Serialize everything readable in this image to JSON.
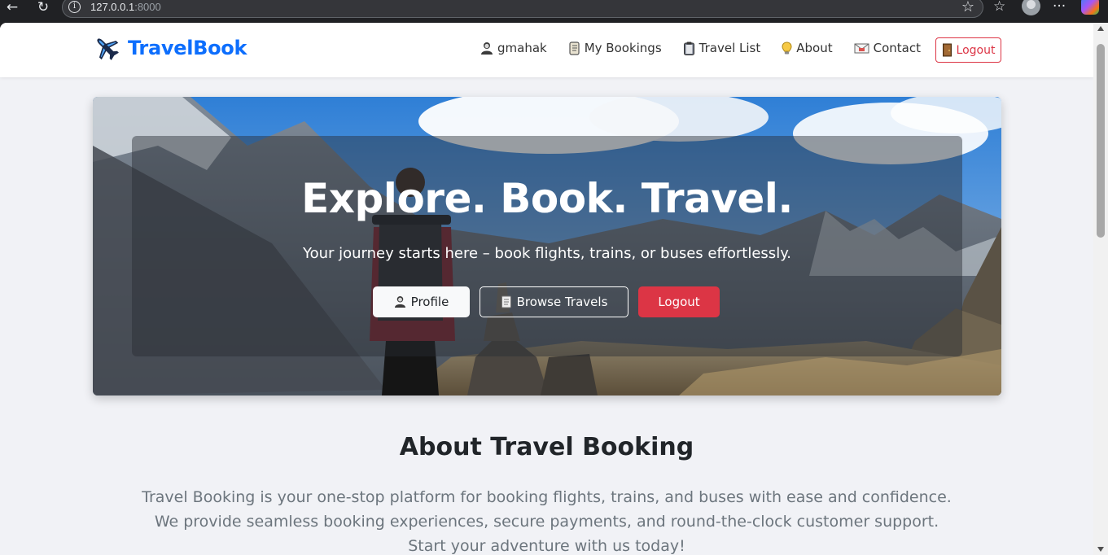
{
  "browser": {
    "url_host": "127.0.0.1",
    "url_port": ":8000"
  },
  "navbar": {
    "brand": "TravelBook",
    "links": [
      {
        "label": "gmahak",
        "icon": "user-icon"
      },
      {
        "label": "My Bookings",
        "icon": "scroll-icon"
      },
      {
        "label": "Travel List",
        "icon": "clipboard-icon"
      },
      {
        "label": "About",
        "icon": "lightbulb-icon"
      },
      {
        "label": "Contact",
        "icon": "envelope-icon"
      }
    ],
    "logout_label": "Logout"
  },
  "hero": {
    "title": "Explore. Book. Travel.",
    "subtitle": "Your journey starts here – book flights, trains, or buses effortlessly.",
    "buttons": {
      "profile": "Profile",
      "browse": "Browse Travels",
      "logout": "Logout"
    }
  },
  "about": {
    "title": "About Travel Booking",
    "text": "Travel Booking is your one-stop platform for booking flights, trains, and buses with ease and confidence. We provide seamless booking experiences, secure payments, and round-the-clock customer support. Start your adventure with us today!"
  },
  "colors": {
    "brand": "#0d6efd",
    "danger": "#dc3545",
    "page_bg": "#f1f2f6"
  }
}
